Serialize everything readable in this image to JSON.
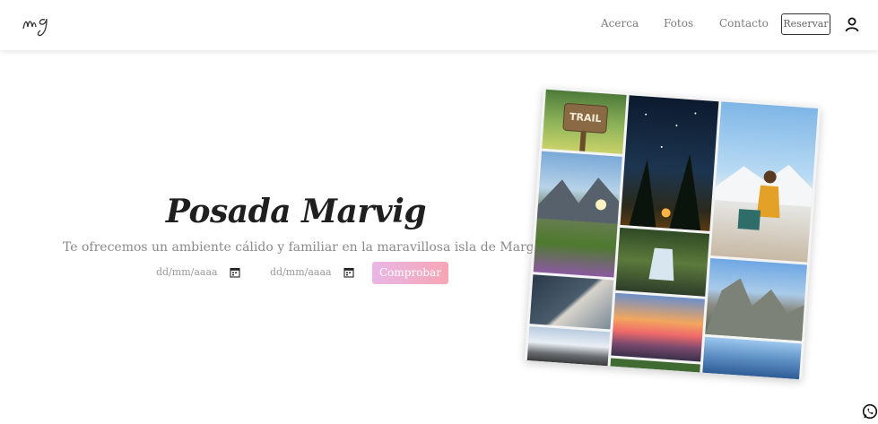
{
  "nav": {
    "logo_text": "mg",
    "links": [
      "Acerca",
      "Fotos",
      "Contacto"
    ],
    "reserve_label": "Reservar",
    "user_icon": "user-icon"
  },
  "hero": {
    "title": "Posada Marvig",
    "subtitle": "Te ofrecemos un ambiente cálido y familiar en la maravillosa isla de Margarita",
    "date_in_placeholder": "dd/mm/aaaa",
    "date_out_placeholder": "dd/mm/aaaa",
    "check_label": "Comprobar",
    "check_gradient": [
      "#e9b6e6",
      "#f6a6b4"
    ]
  },
  "collage": {
    "sign_text": "TRAIL"
  },
  "floating": {
    "whatsapp_icon": "whatsapp-icon"
  }
}
